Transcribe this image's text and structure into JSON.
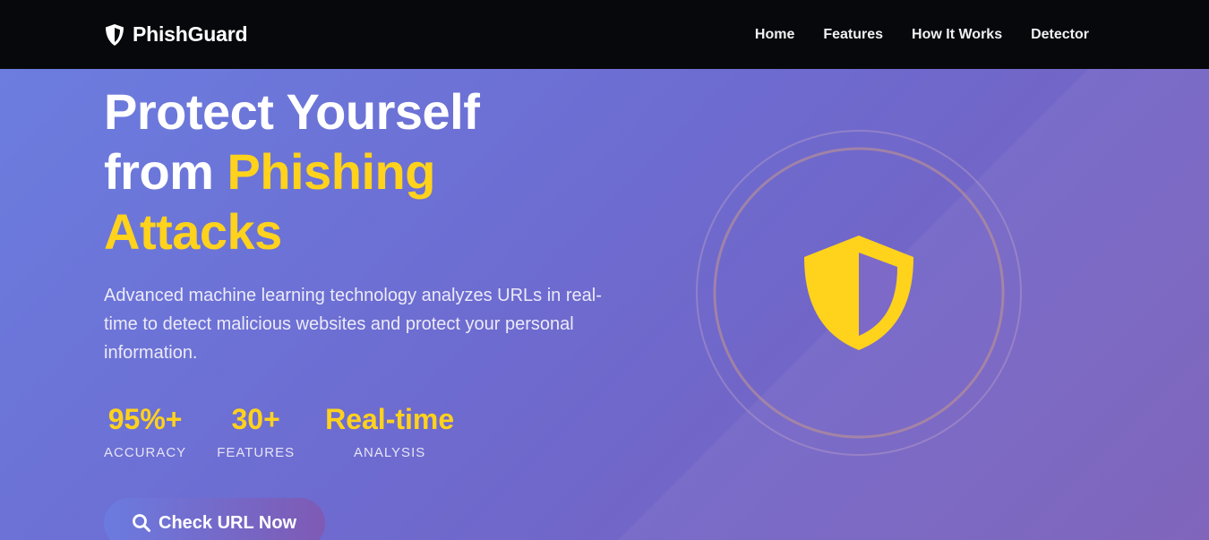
{
  "brand": {
    "name": "PhishGuard",
    "icon": "shield-icon"
  },
  "nav": {
    "links": [
      "Home",
      "Features",
      "How It Works",
      "Detector"
    ]
  },
  "hero": {
    "title_line1": "Protect Yourself",
    "title_line2_prefix": "from ",
    "title_line2_accent": "Phishing",
    "title_line3_accent": "Attacks",
    "description": "Advanced machine learning technology analyzes URLs in real-time to detect malicious websites and protect your personal information.",
    "stats": [
      {
        "value": "95%+",
        "label": "ACCURACY"
      },
      {
        "value": "30+",
        "label": "FEATURES"
      },
      {
        "value": "Real-time",
        "label": "ANALYSIS"
      }
    ],
    "cta": {
      "label": "Check URL Now",
      "icon": "search-icon"
    },
    "illustration_icon": "shield-icon"
  },
  "colors": {
    "nav_bg": "#07080b",
    "accent": "#ffd21c",
    "hero_start": "#6c7ddf",
    "hero_end": "#7a5db8"
  }
}
